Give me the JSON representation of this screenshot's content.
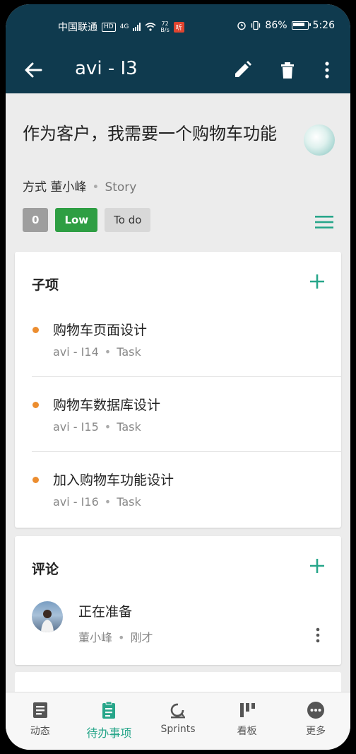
{
  "status_bar": {
    "carrier": "中国联通",
    "hd_label": "HD",
    "network": "4G",
    "net_speed_value": "72",
    "net_speed_unit": "B/s",
    "app_badge": "听",
    "battery": "86%",
    "time": "5:26"
  },
  "app_bar": {
    "title": "avi - I3"
  },
  "issue": {
    "title": "作为客户，我需要一个购物车功能",
    "reporter_prefix": "方式",
    "reporter": "董小峰",
    "type": "Story",
    "points": "0",
    "priority": "Low",
    "status": "To do"
  },
  "subitems": {
    "heading": "子项",
    "items": [
      {
        "name": "购物车页面设计",
        "key": "avi - I14",
        "type": "Task"
      },
      {
        "name": "购物车数据库设计",
        "key": "avi - I15",
        "type": "Task"
      },
      {
        "name": "加入购物车功能设计",
        "key": "avi - I16",
        "type": "Task"
      }
    ]
  },
  "comments": {
    "heading": "评论",
    "items": [
      {
        "text": "正在准备",
        "author": "董小峰",
        "time": "刚才"
      }
    ]
  },
  "bottom_nav": {
    "items": [
      {
        "label": "动态",
        "icon": "activity-icon"
      },
      {
        "label": "待办事项",
        "icon": "backlog-clipboard-icon"
      },
      {
        "label": "Sprints",
        "icon": "sprints-icon"
      },
      {
        "label": "看板",
        "icon": "board-icon"
      },
      {
        "label": "更多",
        "icon": "more-icon"
      }
    ],
    "active_index": 1
  },
  "colors": {
    "header_bg": "#0f3a4e",
    "accent": "#27a68a",
    "priority_low": "#2e9e43",
    "bullet": "#ec8d2f"
  }
}
